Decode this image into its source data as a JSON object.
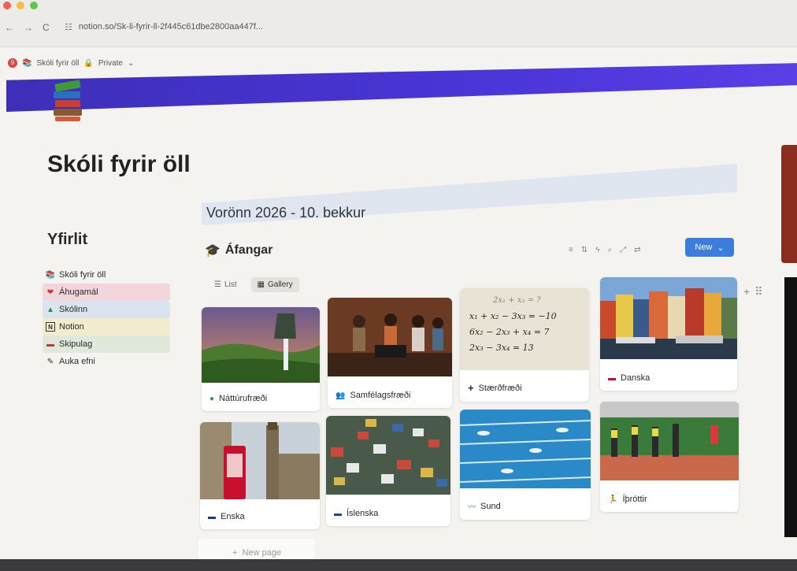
{
  "browser": {
    "url": "notion.so/Sk-li-fyrir-ll-2f445c61dbe2800aa447f...",
    "nav_back": "←",
    "nav_forward": "→",
    "nav_reload": "C"
  },
  "breadcrumb": {
    "notification_count": "9",
    "page_name": "Skóli fyrir öll",
    "privacy": "Private",
    "privacy_chevron": "⌄"
  },
  "page": {
    "title": "Skóli fyrir öll",
    "heading": "Vorönn 2026 - 10. bekkur"
  },
  "sidebar": {
    "title": "Yfirlit",
    "items": [
      {
        "label": "Skóli fyrir öll",
        "icon": "books-icon",
        "bg": "#f4f3f0"
      },
      {
        "label": "Áhugamál",
        "icon": "heart-icon",
        "bg": "#f3d6db"
      },
      {
        "label": "Skólinn",
        "icon": "grad-cap-icon",
        "bg": "#d9e4ee"
      },
      {
        "label": "Notion",
        "icon": "notion-icon",
        "bg": "#f0eccd"
      },
      {
        "label": "Skipulag",
        "icon": "calendar-icon",
        "bg": "#dfe8db"
      },
      {
        "label": "Auka efni",
        "icon": "paperclip-icon",
        "bg": "#f4f3f0"
      }
    ]
  },
  "database": {
    "title": "Áfangar",
    "views": [
      {
        "label": "List",
        "active": false
      },
      {
        "label": "Gallery",
        "active": true
      }
    ],
    "new_label": "New",
    "new_page_label": "New page",
    "cards": [
      {
        "label": "Náttúrufræði",
        "icon": "globe-icon"
      },
      {
        "label": "Samfélagsfræði",
        "icon": "people-icon"
      },
      {
        "label": "Stærðfræði",
        "icon": "plus-icon"
      },
      {
        "label": "Danska",
        "icon": "flag-dk-icon"
      },
      {
        "label": "Enska",
        "icon": "flag-uk-icon"
      },
      {
        "label": "Íslenska",
        "icon": "flag-is-icon"
      },
      {
        "label": "Sund",
        "icon": "swimmer-icon"
      },
      {
        "label": "Íþróttir",
        "icon": "runner-icon"
      }
    ],
    "equations": [
      "2x₁ + x₃ = ?",
      "x₁ + x₂ − 3x₃ = −10",
      "6x₂ − 2x₃ + x₄ = 7",
      "2x₃ − 3x₄ = 13"
    ]
  },
  "colors": {
    "accent": "#3b7ddd",
    "cover": "#4a35d8"
  }
}
